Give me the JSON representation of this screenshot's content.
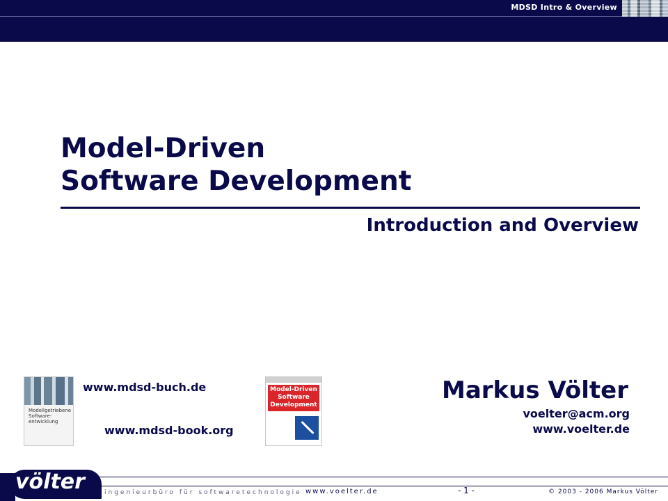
{
  "header": {
    "label": "MDSD Intro & Overview"
  },
  "slide": {
    "title_line1": "Model-Driven",
    "title_line2": "Software Development",
    "subtitle": "Introduction and Overview"
  },
  "books": {
    "german": {
      "title": "Modellgetriebene Software-entwicklung",
      "url": "www.mdsd-buch.de"
    },
    "english": {
      "title": "Model-Driven Software Development",
      "url": "www.mdsd-book.org"
    }
  },
  "author": {
    "name": "Markus Völter",
    "email": "voelter@acm.org",
    "website": "www.voelter.de"
  },
  "footer": {
    "logo_text": "völter",
    "tagline": "ingenieurbüro für softwaretechnologie",
    "url": "www.voelter.de",
    "page": "- 1 -",
    "copyright": "© 2003 - 2006 Markus Völter"
  }
}
